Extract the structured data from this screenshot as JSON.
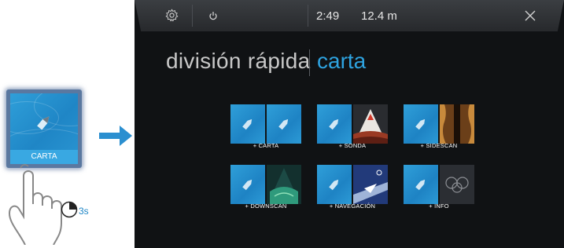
{
  "illustration": {
    "tile_label": "CARTA",
    "timer_label": "3s"
  },
  "screen": {
    "topbar": {
      "time": "2:49",
      "depth": "12.4 m"
    },
    "title": "división rápida",
    "selected": "carta",
    "accent": "#2ea3e0",
    "options": [
      {
        "label": "+ CARTA",
        "second_pane": "chart"
      },
      {
        "label": "+ SONDA",
        "second_pane": "sonar"
      },
      {
        "label": "+ SIDESCAN",
        "second_pane": "sidescan"
      },
      {
        "label": "+ DOWNSCAN",
        "second_pane": "downscan"
      },
      {
        "label": "+ NAVEGACIÓN",
        "second_pane": "navigation"
      },
      {
        "label": "+ INFO",
        "second_pane": "info"
      }
    ]
  }
}
